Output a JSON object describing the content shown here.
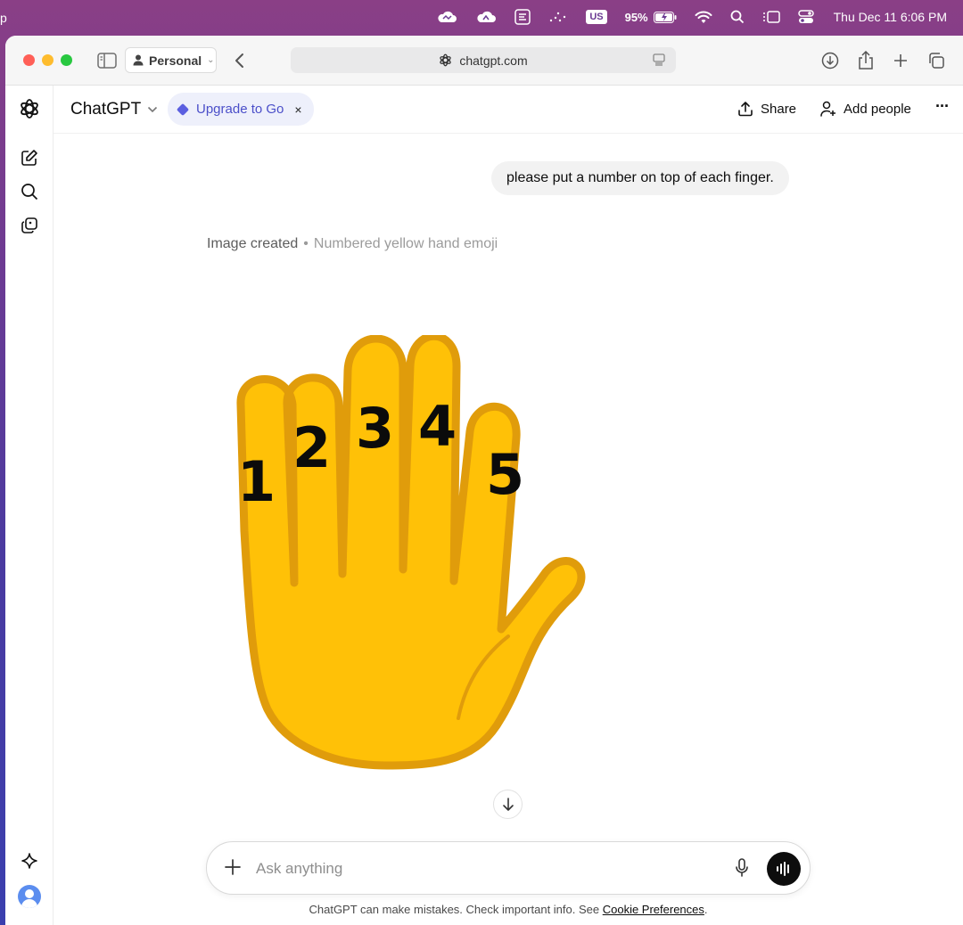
{
  "menubar": {
    "left_clip": "p",
    "keyboard_layout": "US",
    "battery": "95%",
    "datetime": "Thu Dec 11  6:06 PM"
  },
  "browser": {
    "profile": "Personal",
    "url": "chatgpt.com"
  },
  "header": {
    "model": "ChatGPT",
    "upgrade_label": "Upgrade to Go",
    "upgrade_close": "×",
    "share_label": "Share",
    "add_people_label": "Add people",
    "more_label": "···"
  },
  "conversation": {
    "user_message": "please put a number on top of each finger.",
    "image_created_label": "Image created",
    "image_separator": "•",
    "image_description": "Numbered yellow hand emoji",
    "finger_numbers": [
      "1",
      "2",
      "3",
      "4",
      "5"
    ]
  },
  "composer": {
    "placeholder": "Ask anything",
    "value": ""
  },
  "footer": {
    "disclaimer_text": "ChatGPT can make mistakes. Check important info. See ",
    "cookie_link": "Cookie Preferences",
    "disclaimer_end": "."
  },
  "colors": {
    "hand_fill": "#FFC107",
    "hand_outline": "#E09C0B",
    "accent": "#4B4FC9"
  }
}
